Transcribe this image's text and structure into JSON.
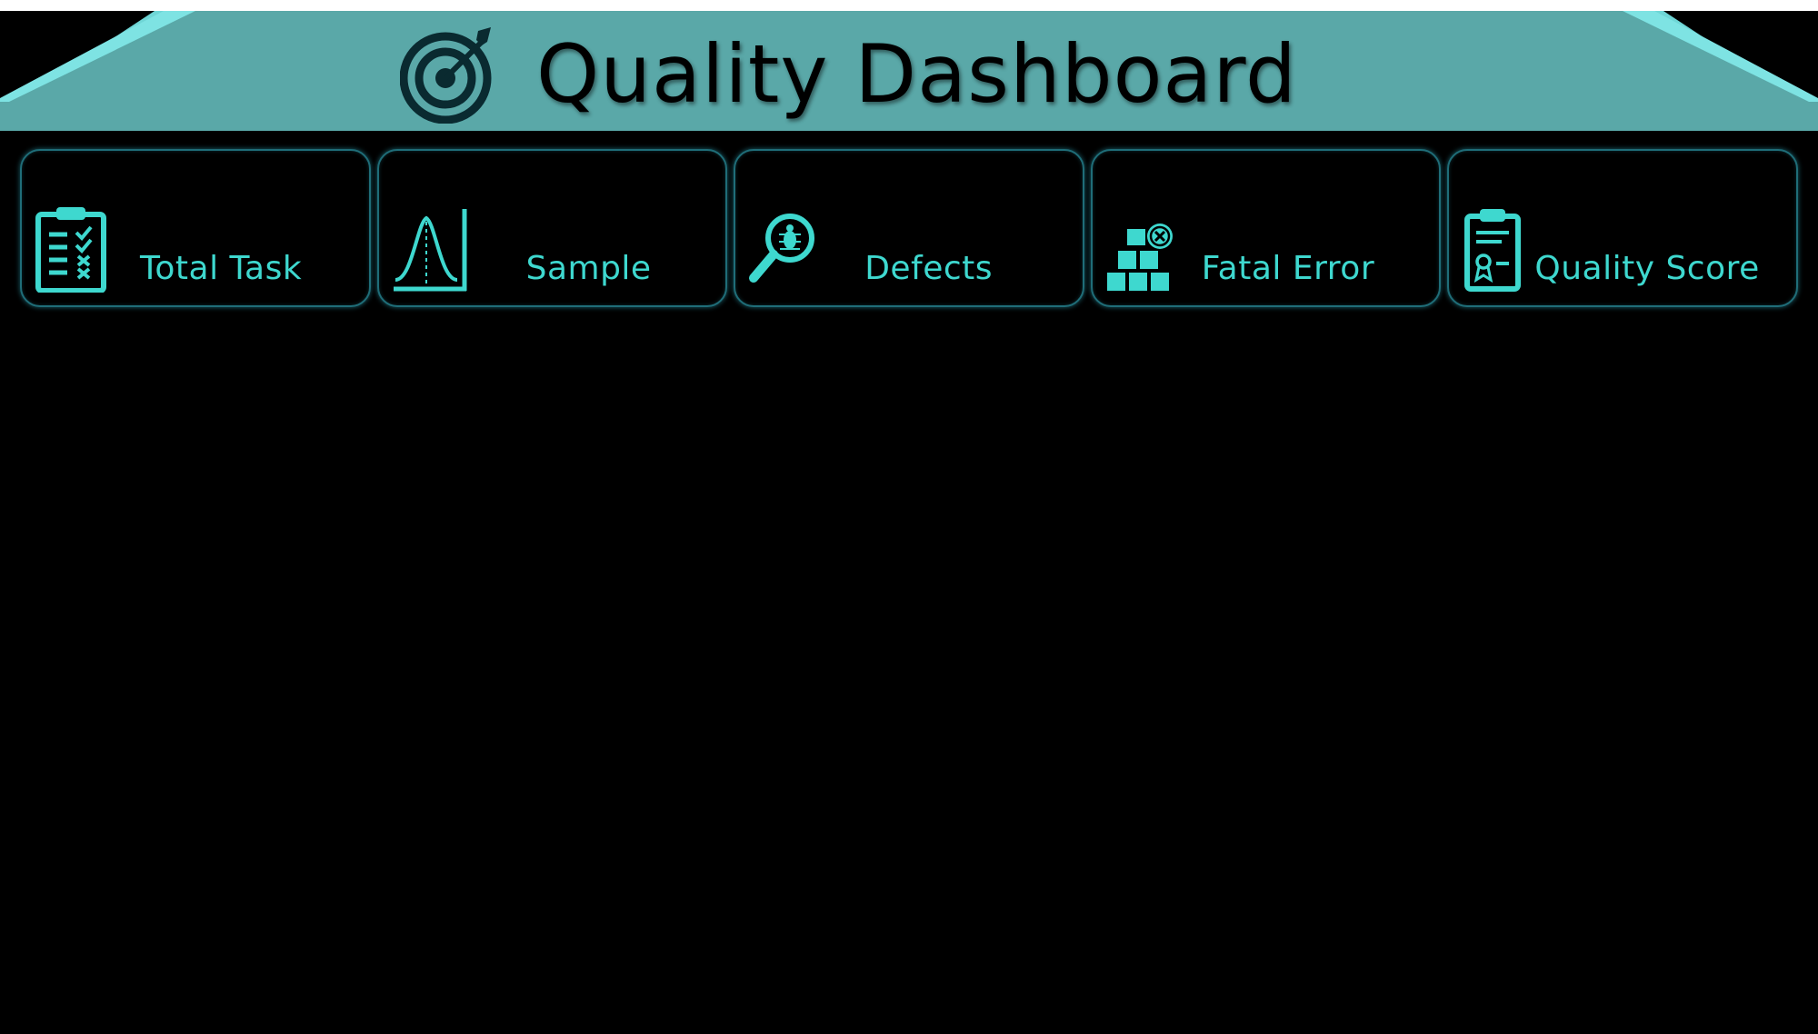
{
  "header": {
    "title": "Quality Dashboard",
    "icon": "target-arrow-icon"
  },
  "colors": {
    "background": "#000000",
    "banner": "#5aa8a8",
    "banner_edge": "#6fd6d6",
    "accent": "#3ed8cf",
    "card_border": "#1f6d78"
  },
  "cards": [
    {
      "label": "Total Task",
      "icon": "clipboard-checklist-icon"
    },
    {
      "label": "Sample",
      "icon": "bell-curve-icon"
    },
    {
      "label": "Defects",
      "icon": "magnifier-bug-icon"
    },
    {
      "label": "Fatal Error",
      "icon": "boxes-error-icon"
    },
    {
      "label": "Quality Score",
      "icon": "clipboard-certificate-icon"
    }
  ]
}
